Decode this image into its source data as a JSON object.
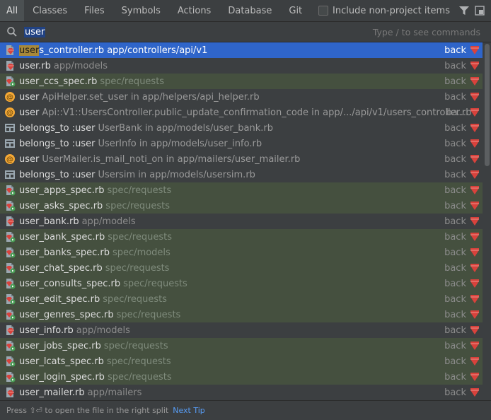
{
  "tabs": [
    {
      "label": "All",
      "active": true
    },
    {
      "label": "Classes"
    },
    {
      "label": "Files"
    },
    {
      "label": "Symbols"
    },
    {
      "label": "Actions"
    },
    {
      "label": "Database"
    },
    {
      "label": "Git"
    }
  ],
  "include_label": "Include non-project items",
  "search": {
    "query": "user",
    "hint": "Type / to see commands"
  },
  "rows": [
    {
      "icon": "ruby-file-icon",
      "hl": "user",
      "name": "s_controller.rb",
      "loc": "app/controllers/api/v1",
      "branch": "back",
      "test": false,
      "selected": true
    },
    {
      "icon": "ruby-file-icon",
      "name": "user.rb",
      "loc": "app/models",
      "branch": "back",
      "test": false
    },
    {
      "icon": "ruby-test-file-icon",
      "name": "user_ccs_spec.rb",
      "loc": "spec/requests",
      "branch": "back",
      "test": true
    },
    {
      "icon": "method-icon",
      "name": "user",
      "ctx": "ApiHelper.set_user in app/helpers/api_helper.rb",
      "branch": "back",
      "test": false
    },
    {
      "icon": "method-icon",
      "name": "user",
      "ctx": "Api::V1::UsersController.public_update_confirmation_code in app/.../api/v1/users_controller.rb",
      "branch": "ba...",
      "test": false
    },
    {
      "icon": "association-icon",
      "name": "belongs_to :user",
      "ctx": "UserBank in app/models/user_bank.rb",
      "branch": "back",
      "test": false
    },
    {
      "icon": "association-icon",
      "name": "belongs_to :user",
      "ctx": "UserInfo in app/models/user_info.rb",
      "branch": "back",
      "test": false
    },
    {
      "icon": "method-icon",
      "name": "user",
      "ctx": "UserMailer.is_mail_noti_on in app/mailers/user_mailer.rb",
      "branch": "back",
      "test": false
    },
    {
      "icon": "association-icon",
      "name": "belongs_to :user",
      "ctx": "Usersim in app/models/usersim.rb",
      "branch": "back",
      "test": false
    },
    {
      "icon": "ruby-test-file-icon",
      "name": "user_apps_spec.rb",
      "loc": "spec/requests",
      "branch": "back",
      "test": true
    },
    {
      "icon": "ruby-test-file-icon",
      "name": "user_asks_spec.rb",
      "loc": "spec/requests",
      "branch": "back",
      "test": true
    },
    {
      "icon": "ruby-file-icon",
      "name": "user_bank.rb",
      "loc": "app/models",
      "branch": "back",
      "test": false
    },
    {
      "icon": "ruby-test-file-icon",
      "name": "user_bank_spec.rb",
      "loc": "spec/requests",
      "branch": "back",
      "test": true
    },
    {
      "icon": "ruby-test-file-icon",
      "name": "user_banks_spec.rb",
      "loc": "spec/models",
      "branch": "back",
      "test": true
    },
    {
      "icon": "ruby-test-file-icon",
      "name": "user_chat_spec.rb",
      "loc": "spec/requests",
      "branch": "back",
      "test": true
    },
    {
      "icon": "ruby-test-file-icon",
      "name": "user_consults_spec.rb",
      "loc": "spec/requests",
      "branch": "back",
      "test": true
    },
    {
      "icon": "ruby-test-file-icon",
      "name": "user_edit_spec.rb",
      "loc": "spec/requests",
      "branch": "back",
      "test": true
    },
    {
      "icon": "ruby-test-file-icon",
      "name": "user_genres_spec.rb",
      "loc": "spec/requests",
      "branch": "back",
      "test": true
    },
    {
      "icon": "ruby-file-icon",
      "name": "user_info.rb",
      "loc": "app/models",
      "branch": "back",
      "test": false
    },
    {
      "icon": "ruby-test-file-icon",
      "name": "user_jobs_spec.rb",
      "loc": "spec/requests",
      "branch": "back",
      "test": true
    },
    {
      "icon": "ruby-test-file-icon",
      "name": "user_lcats_spec.rb",
      "loc": "spec/requests",
      "branch": "back",
      "test": true
    },
    {
      "icon": "ruby-test-file-icon",
      "name": "user_login_spec.rb",
      "loc": "spec/requests",
      "branch": "back",
      "test": true
    },
    {
      "icon": "ruby-file-icon",
      "name": "user_mailer.rb",
      "loc": "app/mailers",
      "branch": "back",
      "test": false
    }
  ],
  "footer": {
    "text": "Press ⇧⏎ to open the file in the right split",
    "tip": "Next Tip"
  },
  "colors": {
    "selection": "#2f65ca",
    "test_row": "#45503f",
    "background": "#3c3f41",
    "link": "#589df6"
  }
}
